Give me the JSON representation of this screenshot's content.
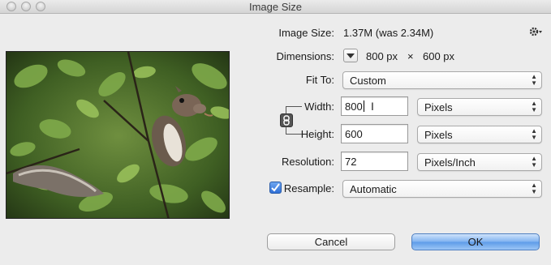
{
  "window": {
    "title": "Image Size"
  },
  "info": {
    "image_size_label": "Image Size:",
    "image_size_value": "1.37M (was 2.34M)",
    "dimensions_label": "Dimensions:",
    "dimensions_width": "800 px",
    "dimensions_sep": "×",
    "dimensions_height": "600 px"
  },
  "form": {
    "fit_to_label": "Fit To:",
    "fit_to_value": "Custom",
    "width_label": "Width:",
    "width_value": "800",
    "width_unit": "Pixels",
    "height_label": "Height:",
    "height_value": "600",
    "height_unit": "Pixels",
    "resolution_label": "Resolution:",
    "resolution_value": "72",
    "resolution_unit": "Pixels/Inch",
    "resample_label": "Resample:",
    "resample_checked": true,
    "resample_value": "Automatic"
  },
  "buttons": {
    "cancel": "Cancel",
    "ok": "OK"
  },
  "icons": {
    "settings": "gear-icon",
    "link": "chain-link-icon",
    "dimensions_menu": "triangle-down-icon",
    "checkbox": "checkmark-icon"
  },
  "colors": {
    "dialog_bg": "#ececec",
    "ok_button": "#5d9be8",
    "checkbox": "#3b7ddd"
  }
}
